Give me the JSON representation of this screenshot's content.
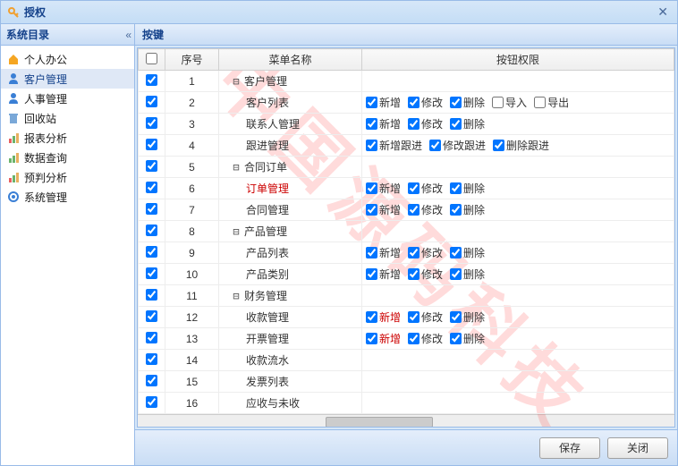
{
  "window": {
    "title": "授权"
  },
  "sidebar": {
    "title": "系统目录",
    "items": [
      {
        "label": "个人办公",
        "icon": "home",
        "color": "#f5a623"
      },
      {
        "label": "客户管理",
        "icon": "user",
        "color": "#3a7fd5",
        "selected": true
      },
      {
        "label": "人事管理",
        "icon": "person",
        "color": "#3a7fd5"
      },
      {
        "label": "回收站",
        "icon": "trash",
        "color": "#7aa8d8"
      },
      {
        "label": "报表分析",
        "icon": "chart",
        "color": "#e86060"
      },
      {
        "label": "数据查询",
        "icon": "chart",
        "color": "#6bb36b"
      },
      {
        "label": "预判分析",
        "icon": "chart",
        "color": "#e86060"
      },
      {
        "label": "系统管理",
        "icon": "gear",
        "color": "#3a7fd5"
      }
    ]
  },
  "main": {
    "header": "按键",
    "columns": {
      "seq": "序号",
      "menu": "菜单名称",
      "perms": "按钮权限"
    },
    "rows": [
      {
        "seq": 1,
        "menu": "客户管理",
        "expander": "⊟",
        "perms": []
      },
      {
        "seq": 2,
        "menu": "客户列表",
        "perms": [
          {
            "label": "新增",
            "checked": true
          },
          {
            "label": "修改",
            "checked": true
          },
          {
            "label": "删除",
            "checked": true
          },
          {
            "label": "导入",
            "checked": false
          },
          {
            "label": "导出",
            "checked": false
          }
        ]
      },
      {
        "seq": 3,
        "menu": "联系人管理",
        "perms": [
          {
            "label": "新增",
            "checked": true
          },
          {
            "label": "修改",
            "checked": true
          },
          {
            "label": "删除",
            "checked": true
          }
        ]
      },
      {
        "seq": 4,
        "menu": "跟进管理",
        "perms": [
          {
            "label": "新增跟进",
            "checked": true
          },
          {
            "label": "修改跟进",
            "checked": true
          },
          {
            "label": "删除跟进",
            "checked": true
          }
        ]
      },
      {
        "seq": 5,
        "menu": "合同订单",
        "expander": "⊟",
        "perms": []
      },
      {
        "seq": 6,
        "menu": "订单管理",
        "red": true,
        "perms": [
          {
            "label": "新增",
            "checked": true
          },
          {
            "label": "修改",
            "checked": true
          },
          {
            "label": "删除",
            "checked": true
          }
        ]
      },
      {
        "seq": 7,
        "menu": "合同管理",
        "perms": [
          {
            "label": "新增",
            "checked": true
          },
          {
            "label": "修改",
            "checked": true
          },
          {
            "label": "删除",
            "checked": true
          }
        ]
      },
      {
        "seq": 8,
        "menu": "产品管理",
        "expander": "⊟",
        "perms": []
      },
      {
        "seq": 9,
        "menu": "产品列表",
        "perms": [
          {
            "label": "新增",
            "checked": true
          },
          {
            "label": "修改",
            "checked": true
          },
          {
            "label": "删除",
            "checked": true
          }
        ]
      },
      {
        "seq": 10,
        "menu": "产品类别",
        "perms": [
          {
            "label": "新增",
            "checked": true
          },
          {
            "label": "修改",
            "checked": true
          },
          {
            "label": "删除",
            "checked": true
          }
        ]
      },
      {
        "seq": 11,
        "menu": "财务管理",
        "expander": "⊟",
        "perms": []
      },
      {
        "seq": 12,
        "menu": "收款管理",
        "perms": [
          {
            "label": "新增",
            "checked": true,
            "red": true
          },
          {
            "label": "修改",
            "checked": true
          },
          {
            "label": "删除",
            "checked": true
          }
        ]
      },
      {
        "seq": 13,
        "menu": "开票管理",
        "perms": [
          {
            "label": "新增",
            "checked": true,
            "red": true
          },
          {
            "label": "修改",
            "checked": true
          },
          {
            "label": "删除",
            "checked": true
          }
        ]
      },
      {
        "seq": 14,
        "menu": "收款流水",
        "perms": []
      },
      {
        "seq": 15,
        "menu": "发票列表",
        "perms": []
      },
      {
        "seq": 16,
        "menu": "应收与未收",
        "perms": []
      }
    ]
  },
  "footer": {
    "save": "保存",
    "close": "关闭"
  },
  "watermark": "中国源码科技"
}
